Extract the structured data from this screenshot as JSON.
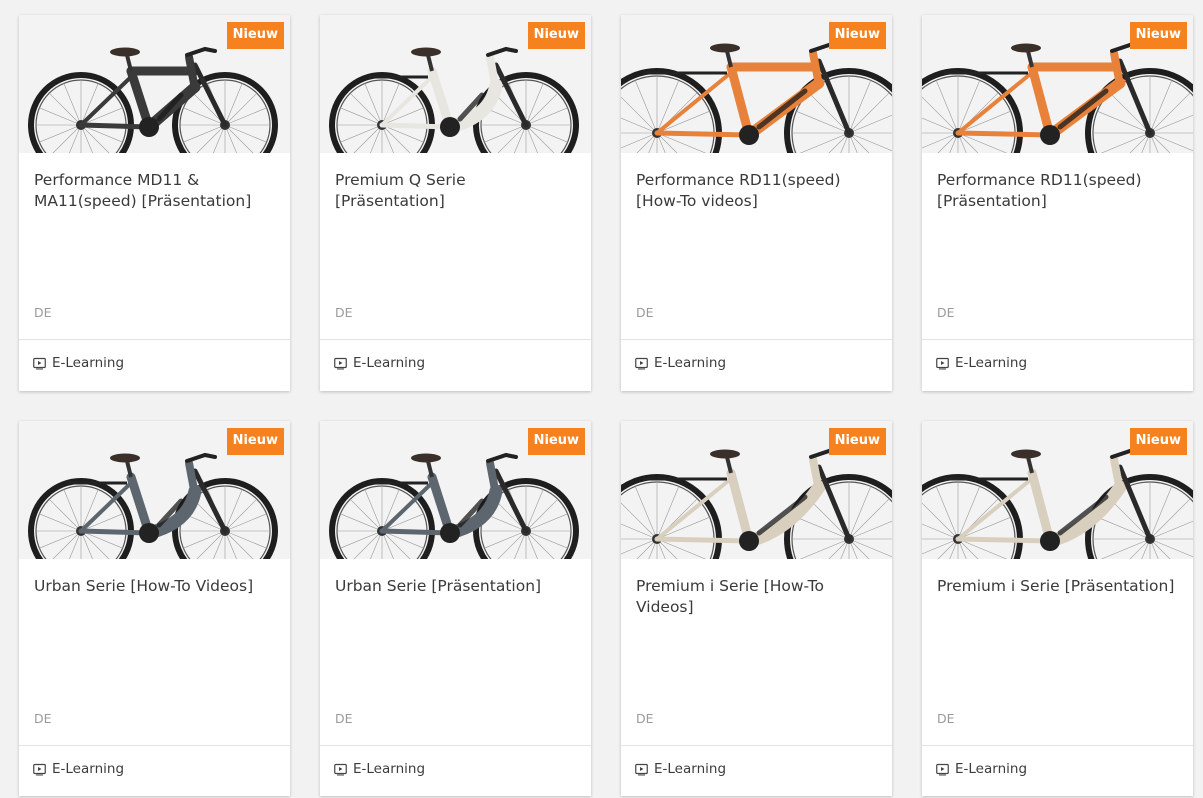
{
  "colors": {
    "accent": "#f5821f",
    "card_bg": "#ffffff",
    "page_bg": "#f2f2f2"
  },
  "cards": [
    {
      "badge": "Nieuw",
      "title": "Performance MD11 & MA11(speed) [Präsentation]",
      "language": "DE",
      "type_label": "E-Learning",
      "type_icon": "video-play-icon",
      "bike_color": "#3a3a3a",
      "bike_style": "diamond"
    },
    {
      "badge": "Nieuw",
      "title": "Premium Q Serie [Präsentation]",
      "language": "DE",
      "type_label": "E-Learning",
      "type_icon": "video-play-icon",
      "bike_color": "#e8e6e0",
      "bike_style": "lowstep"
    },
    {
      "badge": "Nieuw",
      "title": "Performance RD11(speed) [How-To videos]",
      "language": "DE",
      "type_label": "E-Learning",
      "type_icon": "video-play-icon",
      "bike_color": "#e8823a",
      "bike_style": "diamond-close"
    },
    {
      "badge": "Nieuw",
      "title": "Performance RD11(speed) [Präsentation]",
      "language": "DE",
      "type_label": "E-Learning",
      "type_icon": "video-play-icon",
      "bike_color": "#e8823a",
      "bike_style": "diamond-close"
    },
    {
      "badge": "Nieuw",
      "title": "Urban Serie [How-To Videos]",
      "language": "DE",
      "type_label": "E-Learning",
      "type_icon": "video-play-icon",
      "bike_color": "#5d666e",
      "bike_style": "lowstep"
    },
    {
      "badge": "Nieuw",
      "title": "Urban Serie [Präsentation]",
      "language": "DE",
      "type_label": "E-Learning",
      "type_icon": "video-play-icon",
      "bike_color": "#5d666e",
      "bike_style": "lowstep"
    },
    {
      "badge": "Nieuw",
      "title": "Premium i Serie [How-To Videos]",
      "language": "DE",
      "type_label": "E-Learning",
      "type_icon": "video-play-icon",
      "bike_color": "#d9cfbe",
      "bike_style": "lowstep-close"
    },
    {
      "badge": "Nieuw",
      "title": "Premium i Serie [Präsentation]",
      "language": "DE",
      "type_label": "E-Learning",
      "type_icon": "video-play-icon",
      "bike_color": "#d9cfbe",
      "bike_style": "lowstep-close"
    }
  ]
}
